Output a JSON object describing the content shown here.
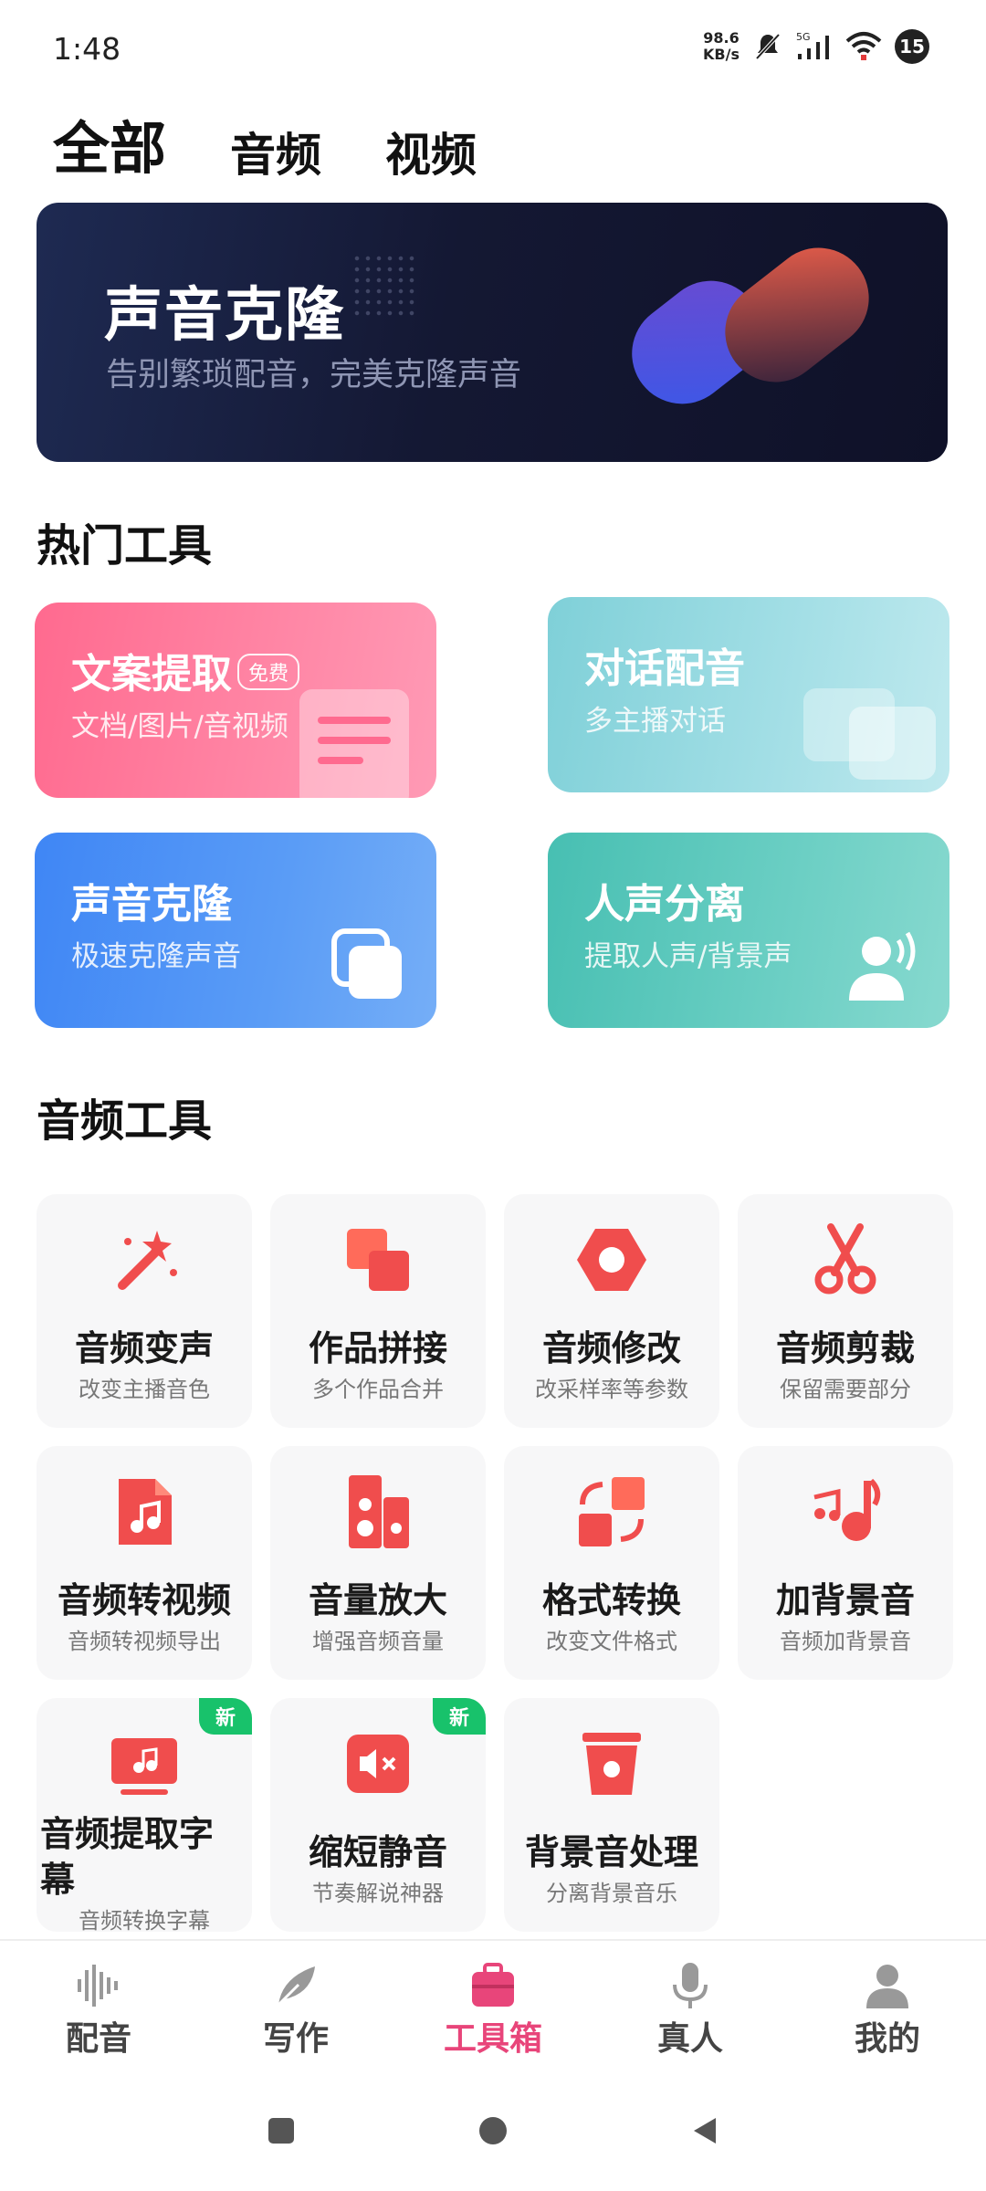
{
  "status": {
    "time": "1:48",
    "speed_value": "98.6",
    "speed_unit": "KB/s",
    "badge": "15"
  },
  "top_tabs": [
    "全部",
    "音频",
    "视频"
  ],
  "banner": {
    "title": "声音克隆",
    "subtitle": "告别繁琐配音，完美克隆声音"
  },
  "hot_section": {
    "title": "热门工具",
    "cards": [
      {
        "title": "文案提取",
        "tag": "免费",
        "subtitle": "文档/图片/音视频"
      },
      {
        "title": "对话配音",
        "subtitle": "多主播对话"
      },
      {
        "title": "声音克隆",
        "subtitle": "极速克隆声音"
      },
      {
        "title": "人声分离",
        "subtitle": "提取人声/背景声"
      }
    ]
  },
  "audio_section": {
    "title": "音频工具",
    "tools": [
      {
        "title": "音频变声",
        "subtitle": "改变主播音色",
        "icon": "magic-wand-icon"
      },
      {
        "title": "作品拼接",
        "subtitle": "多个作品合并",
        "icon": "merge-icon"
      },
      {
        "title": "音频修改",
        "subtitle": "改采样率等参数",
        "icon": "hex-nut-icon"
      },
      {
        "title": "音频剪裁",
        "subtitle": "保留需要部分",
        "icon": "scissors-icon"
      },
      {
        "title": "音频转视频",
        "subtitle": "音频转视频导出",
        "icon": "music-file-icon"
      },
      {
        "title": "音量放大",
        "subtitle": "增强音频音量",
        "icon": "speaker-icon"
      },
      {
        "title": "格式转换",
        "subtitle": "改变文件格式",
        "icon": "convert-icon"
      },
      {
        "title": "加背景音",
        "subtitle": "音频加背景音",
        "icon": "music-note-icon"
      },
      {
        "title": "音频提取字幕",
        "subtitle": "音频转换字幕",
        "badge": "新",
        "icon": "subtitle-icon"
      },
      {
        "title": "缩短静音",
        "subtitle": "节奏解说神器",
        "badge": "新",
        "icon": "mute-icon"
      },
      {
        "title": "背景音处理",
        "subtitle": "分离背景音乐",
        "icon": "bucket-icon"
      }
    ]
  },
  "bottom_nav": [
    {
      "label": "配音",
      "icon": "waveform-icon"
    },
    {
      "label": "写作",
      "icon": "feather-icon"
    },
    {
      "label": "工具箱",
      "icon": "toolbox-icon",
      "active": true
    },
    {
      "label": "真人",
      "icon": "microphone-icon"
    },
    {
      "label": "我的",
      "icon": "person-icon"
    }
  ],
  "colors": {
    "accent": "#e8457a",
    "tool_icon": "#f04d4d",
    "new_badge": "#18c26b"
  }
}
